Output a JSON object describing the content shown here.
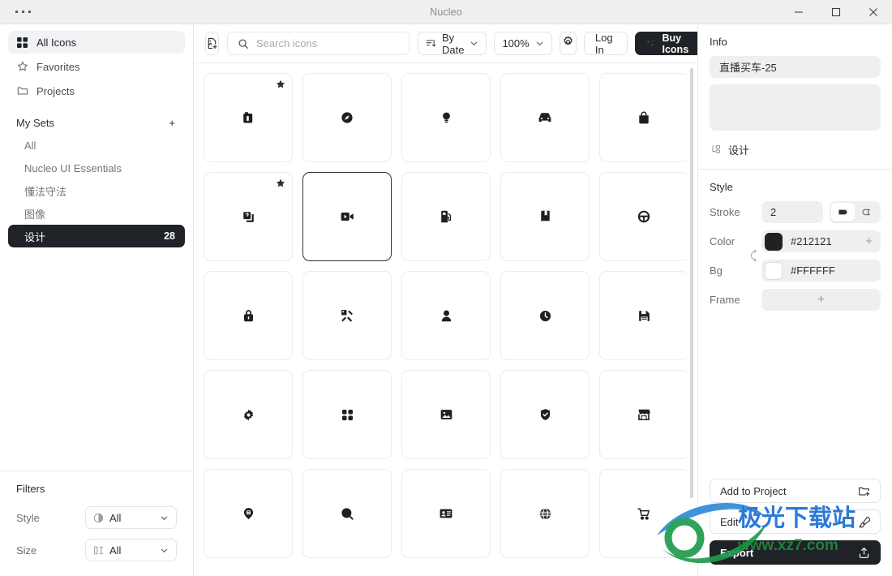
{
  "window": {
    "title": "Nucleo",
    "menu_icon": "ellipsis-icon",
    "minimize_label": "Minimize",
    "maximize_label": "Maximize",
    "close_label": "Close"
  },
  "sidebar": {
    "nav": [
      {
        "label": "All Icons",
        "icon": "grid-icon",
        "active": true
      },
      {
        "label": "Favorites",
        "icon": "star-icon",
        "active": false
      },
      {
        "label": "Projects",
        "icon": "folder-icon",
        "active": false
      }
    ],
    "sets_header": {
      "title": "My Sets",
      "add_label": "+"
    },
    "sets": [
      {
        "label": "All",
        "count": "",
        "active": false
      },
      {
        "label": "Nucleo UI Essentials",
        "count": "",
        "active": false
      },
      {
        "label": "懂法守法",
        "count": "",
        "active": false
      },
      {
        "label": "图像",
        "count": "",
        "active": false
      },
      {
        "label": "设计",
        "count": "28",
        "active": true
      }
    ],
    "filters": {
      "title": "Filters",
      "rows": [
        {
          "label": "Style",
          "value": "All",
          "icon": "style-circle-icon"
        },
        {
          "label": "Size",
          "value": "All",
          "icon": "size-icon"
        }
      ]
    }
  },
  "toolbar": {
    "add_icon_label": "add-icon-file",
    "search": {
      "placeholder": "Search icons",
      "value": ""
    },
    "sort": {
      "label": "By Date",
      "icon": "sort-icon"
    },
    "zoom": {
      "label": "100%"
    },
    "settings_label": "gear-icon",
    "login_label": "Log In",
    "buy_label": "Buy Icons"
  },
  "grid": {
    "cells": [
      {
        "name": "icon-battery-charging",
        "glyph": "battery",
        "starred": true,
        "selected": false
      },
      {
        "name": "icon-compass",
        "glyph": "compass",
        "starred": false,
        "selected": false
      },
      {
        "name": "icon-lightbulb",
        "glyph": "bulb",
        "starred": false,
        "selected": false
      },
      {
        "name": "icon-car-front",
        "glyph": "car",
        "starred": false,
        "selected": false
      },
      {
        "name": "icon-bag",
        "glyph": "bag",
        "starred": false,
        "selected": false
      },
      {
        "name": "icon-copy-question",
        "glyph": "copy",
        "starred": true,
        "selected": false
      },
      {
        "name": "icon-video-camera",
        "glyph": "video",
        "starred": false,
        "selected": true
      },
      {
        "name": "icon-fuel-pump",
        "glyph": "fuel",
        "starred": false,
        "selected": false
      },
      {
        "name": "icon-book-bookmark",
        "glyph": "book",
        "starred": false,
        "selected": false
      },
      {
        "name": "icon-steering-wheel",
        "glyph": "wheel",
        "starred": false,
        "selected": false
      },
      {
        "name": "icon-lock",
        "glyph": "lock",
        "starred": false,
        "selected": false
      },
      {
        "name": "icon-tags",
        "glyph": "tags",
        "starred": false,
        "selected": false
      },
      {
        "name": "icon-user",
        "glyph": "user",
        "starred": false,
        "selected": false
      },
      {
        "name": "icon-clock",
        "glyph": "clock",
        "starred": false,
        "selected": false
      },
      {
        "name": "icon-save-disk",
        "glyph": "save",
        "starred": false,
        "selected": false
      },
      {
        "name": "icon-gear",
        "glyph": "gear",
        "starred": false,
        "selected": false
      },
      {
        "name": "icon-four-squares",
        "glyph": "quad",
        "starred": false,
        "selected": false
      },
      {
        "name": "icon-image-frame",
        "glyph": "image",
        "starred": false,
        "selected": false
      },
      {
        "name": "icon-shield-check",
        "glyph": "shield",
        "starred": false,
        "selected": false
      },
      {
        "name": "icon-storefront",
        "glyph": "store",
        "starred": false,
        "selected": false
      },
      {
        "name": "icon-map-pin",
        "glyph": "pin",
        "starred": false,
        "selected": false
      },
      {
        "name": "icon-search-magnifier",
        "glyph": "search",
        "starred": false,
        "selected": false
      },
      {
        "name": "icon-id-card",
        "glyph": "idcard",
        "starred": false,
        "selected": false
      },
      {
        "name": "icon-globe",
        "glyph": "globe",
        "starred": false,
        "selected": false
      },
      {
        "name": "icon-shopping-cart",
        "glyph": "cart",
        "starred": false,
        "selected": false
      }
    ]
  },
  "info": {
    "title": "Info",
    "name_value": "直播买车-25",
    "notes_value": "",
    "set_tag": "设计",
    "set_tag_icon": "set-icon"
  },
  "style": {
    "title": "Style",
    "stroke_label": "Stroke",
    "stroke_value": "2",
    "cap_round_label": "rounded-cap",
    "cap_sharp_label": "sharp-cap",
    "color_label": "Color",
    "color_value": "#212121",
    "bg_label": "Bg",
    "bg_value": "#FFFFFF",
    "frame_label": "Frame",
    "frame_add": "+",
    "add_color": "+"
  },
  "actions": {
    "add_to_project": "Add to Project",
    "edit": "Edit",
    "export": "Export"
  },
  "watermark": {
    "line1": "极光下载站",
    "line2": "www.xz7.com"
  }
}
